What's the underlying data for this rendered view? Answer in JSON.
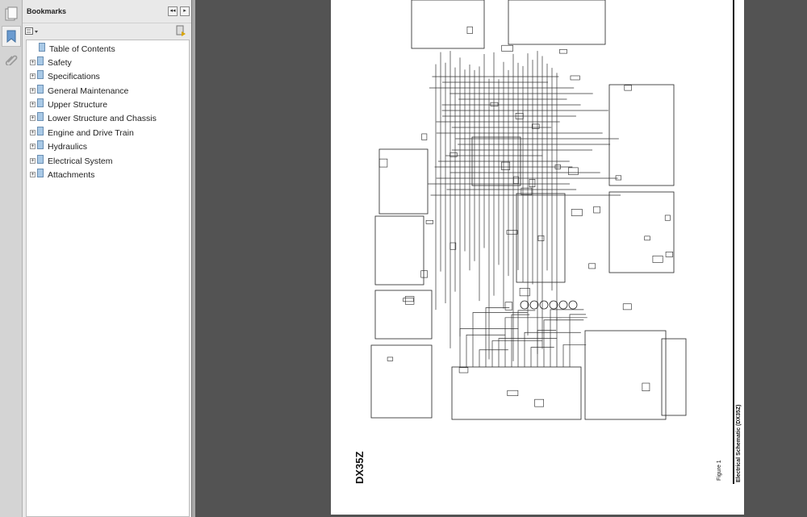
{
  "panel": {
    "title": "Bookmarks",
    "collapse_label": "◂◂",
    "expand_label": "▸"
  },
  "bookmarks": [
    {
      "label": "Table of Contents",
      "expandable": false
    },
    {
      "label": "Safety",
      "expandable": true
    },
    {
      "label": "Specifications",
      "expandable": true
    },
    {
      "label": "General Maintenance",
      "expandable": true
    },
    {
      "label": "Upper Structure",
      "expandable": true
    },
    {
      "label": "Lower Structure and Chassis",
      "expandable": true
    },
    {
      "label": "Engine and Drive Train",
      "expandable": true
    },
    {
      "label": "Hydraulics",
      "expandable": true
    },
    {
      "label": "Electrical System",
      "expandable": true
    },
    {
      "label": "Attachments",
      "expandable": true
    }
  ],
  "document": {
    "model": "DX35Z",
    "figure": "Figure 1",
    "caption": "Electrical Schematic (DX35Z)"
  },
  "icons": {
    "expand": "+",
    "pages": "pages-icon",
    "bookmarks": "bookmark-icon",
    "attachments": "paperclip-icon",
    "options": "options-menu-icon",
    "delete": "bookmark-tool-icon"
  },
  "colors": {
    "viewer_bg": "#535353",
    "panel_bg": "#e9e9e9",
    "bookmark_icon": "#a9c9e6"
  }
}
